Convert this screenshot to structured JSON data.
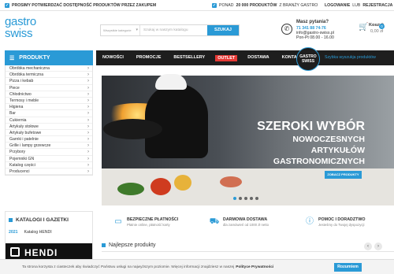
{
  "topbar": {
    "notice1": "PROSIMY POTWIERDZAĆ DOSTĘPNOŚĆ PRODUKTÓW PRZEZ ZAKUPEM",
    "notice2_prefix": "PONAD",
    "notice2_bold": "20 000 PRODUKTÓW",
    "notice2_suffix": "Z BRANŻY GASTRO",
    "login": "LOGOWANIE",
    "separator": "LUB",
    "register": "REJESTRACJA"
  },
  "logo": {
    "line1": "gastro",
    "line2": "swiss"
  },
  "search": {
    "category": "Wszystkie kategorie",
    "placeholder": "Szukaj w naszym katalogu",
    "button": "SZUKAJ"
  },
  "contact": {
    "title": "Masz pytania?",
    "phone": "71 341 88 74-76",
    "email": "info@gastro-swiss.pl",
    "hours": "Pon-Pt 08.00 - 16.00"
  },
  "basket": {
    "label": "Koszyk",
    "count": "0",
    "amount": "0,00 zł"
  },
  "categories": {
    "title": "PRODUKTY",
    "items": [
      "Obróbka mechaniczna",
      "Obróbka termiczna",
      "Pizza i kebab",
      "Piece",
      "Chłodnictwo",
      "Termosy i meble",
      "Higiena",
      "Bar",
      "Cukiernia",
      "Artykuły stołowe",
      "Artykuły bufetowe",
      "Garnki i patelnie",
      "Grille i lampy grzewcze",
      "Przybory",
      "Pojemniki GN",
      "Katalog części",
      "Producenci"
    ]
  },
  "nav": {
    "items": [
      "NOWOŚCI",
      "PROMOCJE",
      "BESTSELLERY",
      "OUTLET",
      "DOSTAWA",
      "KONTAKT"
    ],
    "badge_line1": "GASTRO",
    "badge_line2": "SWISS",
    "quick_search": "Szybka wyszukja produktów"
  },
  "hero": {
    "line1": "SZEROKI WYBÓR",
    "line2": "NOWOCZESNYCH",
    "line3": "ARTYKUŁÓW",
    "line4": "GASTRONOMICZNYCH",
    "cta": "ZOBACZ PRODUKTY"
  },
  "catalogs": {
    "title": "KATALOGI I GAZETKI",
    "year": "2021",
    "name": "Katalog HENDI",
    "banner": "HENDI"
  },
  "features": [
    {
      "title": "BEZPIECZNE PŁATNOŚCI",
      "sub": "Płatnie online, płatność karty",
      "icon": "card-icon"
    },
    {
      "title": "DARMOWA DOSTAWA",
      "sub": "dla zamówień od 1000 zł netto",
      "icon": "truck-icon"
    },
    {
      "title": "POMOC I DORADZTWO",
      "sub": "Jesteśmy do Twojej dyspozycji",
      "icon": "info-icon"
    }
  ],
  "section": {
    "title": "Najlepsze produkty"
  },
  "cookie": {
    "text": "Ta strona korzysta z ciasteczek aby świadczyć Państwu usługi na najwyższym poziomie. Więcej informacji znajdziesz w naszej",
    "policy": "Polityce Prywatności",
    "button": "Rozumiem"
  },
  "colors": {
    "accent": "#2a9ad6",
    "nav_bg": "#1e1e1e",
    "outlet": "#e53935"
  }
}
